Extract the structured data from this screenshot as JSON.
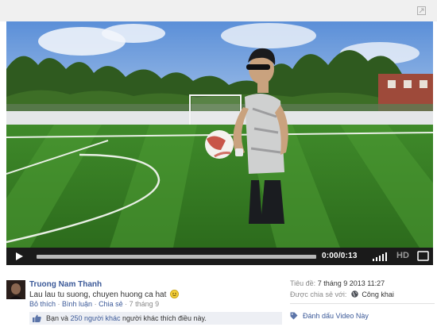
{
  "player": {
    "time_display": "0:00/0:13",
    "hd_label": "HD",
    "progress": 0.0
  },
  "post": {
    "author": "Truong Nam Thanh",
    "caption": "Lau lau tu suong, chuyen huong ca hat",
    "emoji": "smiley",
    "actions": {
      "like": "Bỏ thích",
      "comment": "Bình luận",
      "share": "Chia sẻ",
      "separator": " · ",
      "date": "7 tháng 9"
    },
    "likes": {
      "prefix": "Bạn và ",
      "count_link": "250 người khác",
      "suffix": " người khác thích điều này."
    }
  },
  "meta": {
    "title_label": "Tiêu đề:",
    "title_value": "7 tháng 9 2013 11:27",
    "shared_label": "Được chia sẻ với:",
    "shared_value": "Công khai",
    "bookmark_label": "Đánh dấu Video Này"
  },
  "colors": {
    "link": "#3b5998",
    "muted": "#8a8a8a",
    "likes_bg": "#edeff4",
    "control_bar": "#1a1a1a"
  },
  "icons": [
    "expand-icon",
    "play-icon",
    "volume-icon",
    "fullscreen-icon",
    "smiley-icon",
    "like-icon",
    "globe-icon",
    "tag-icon"
  ]
}
